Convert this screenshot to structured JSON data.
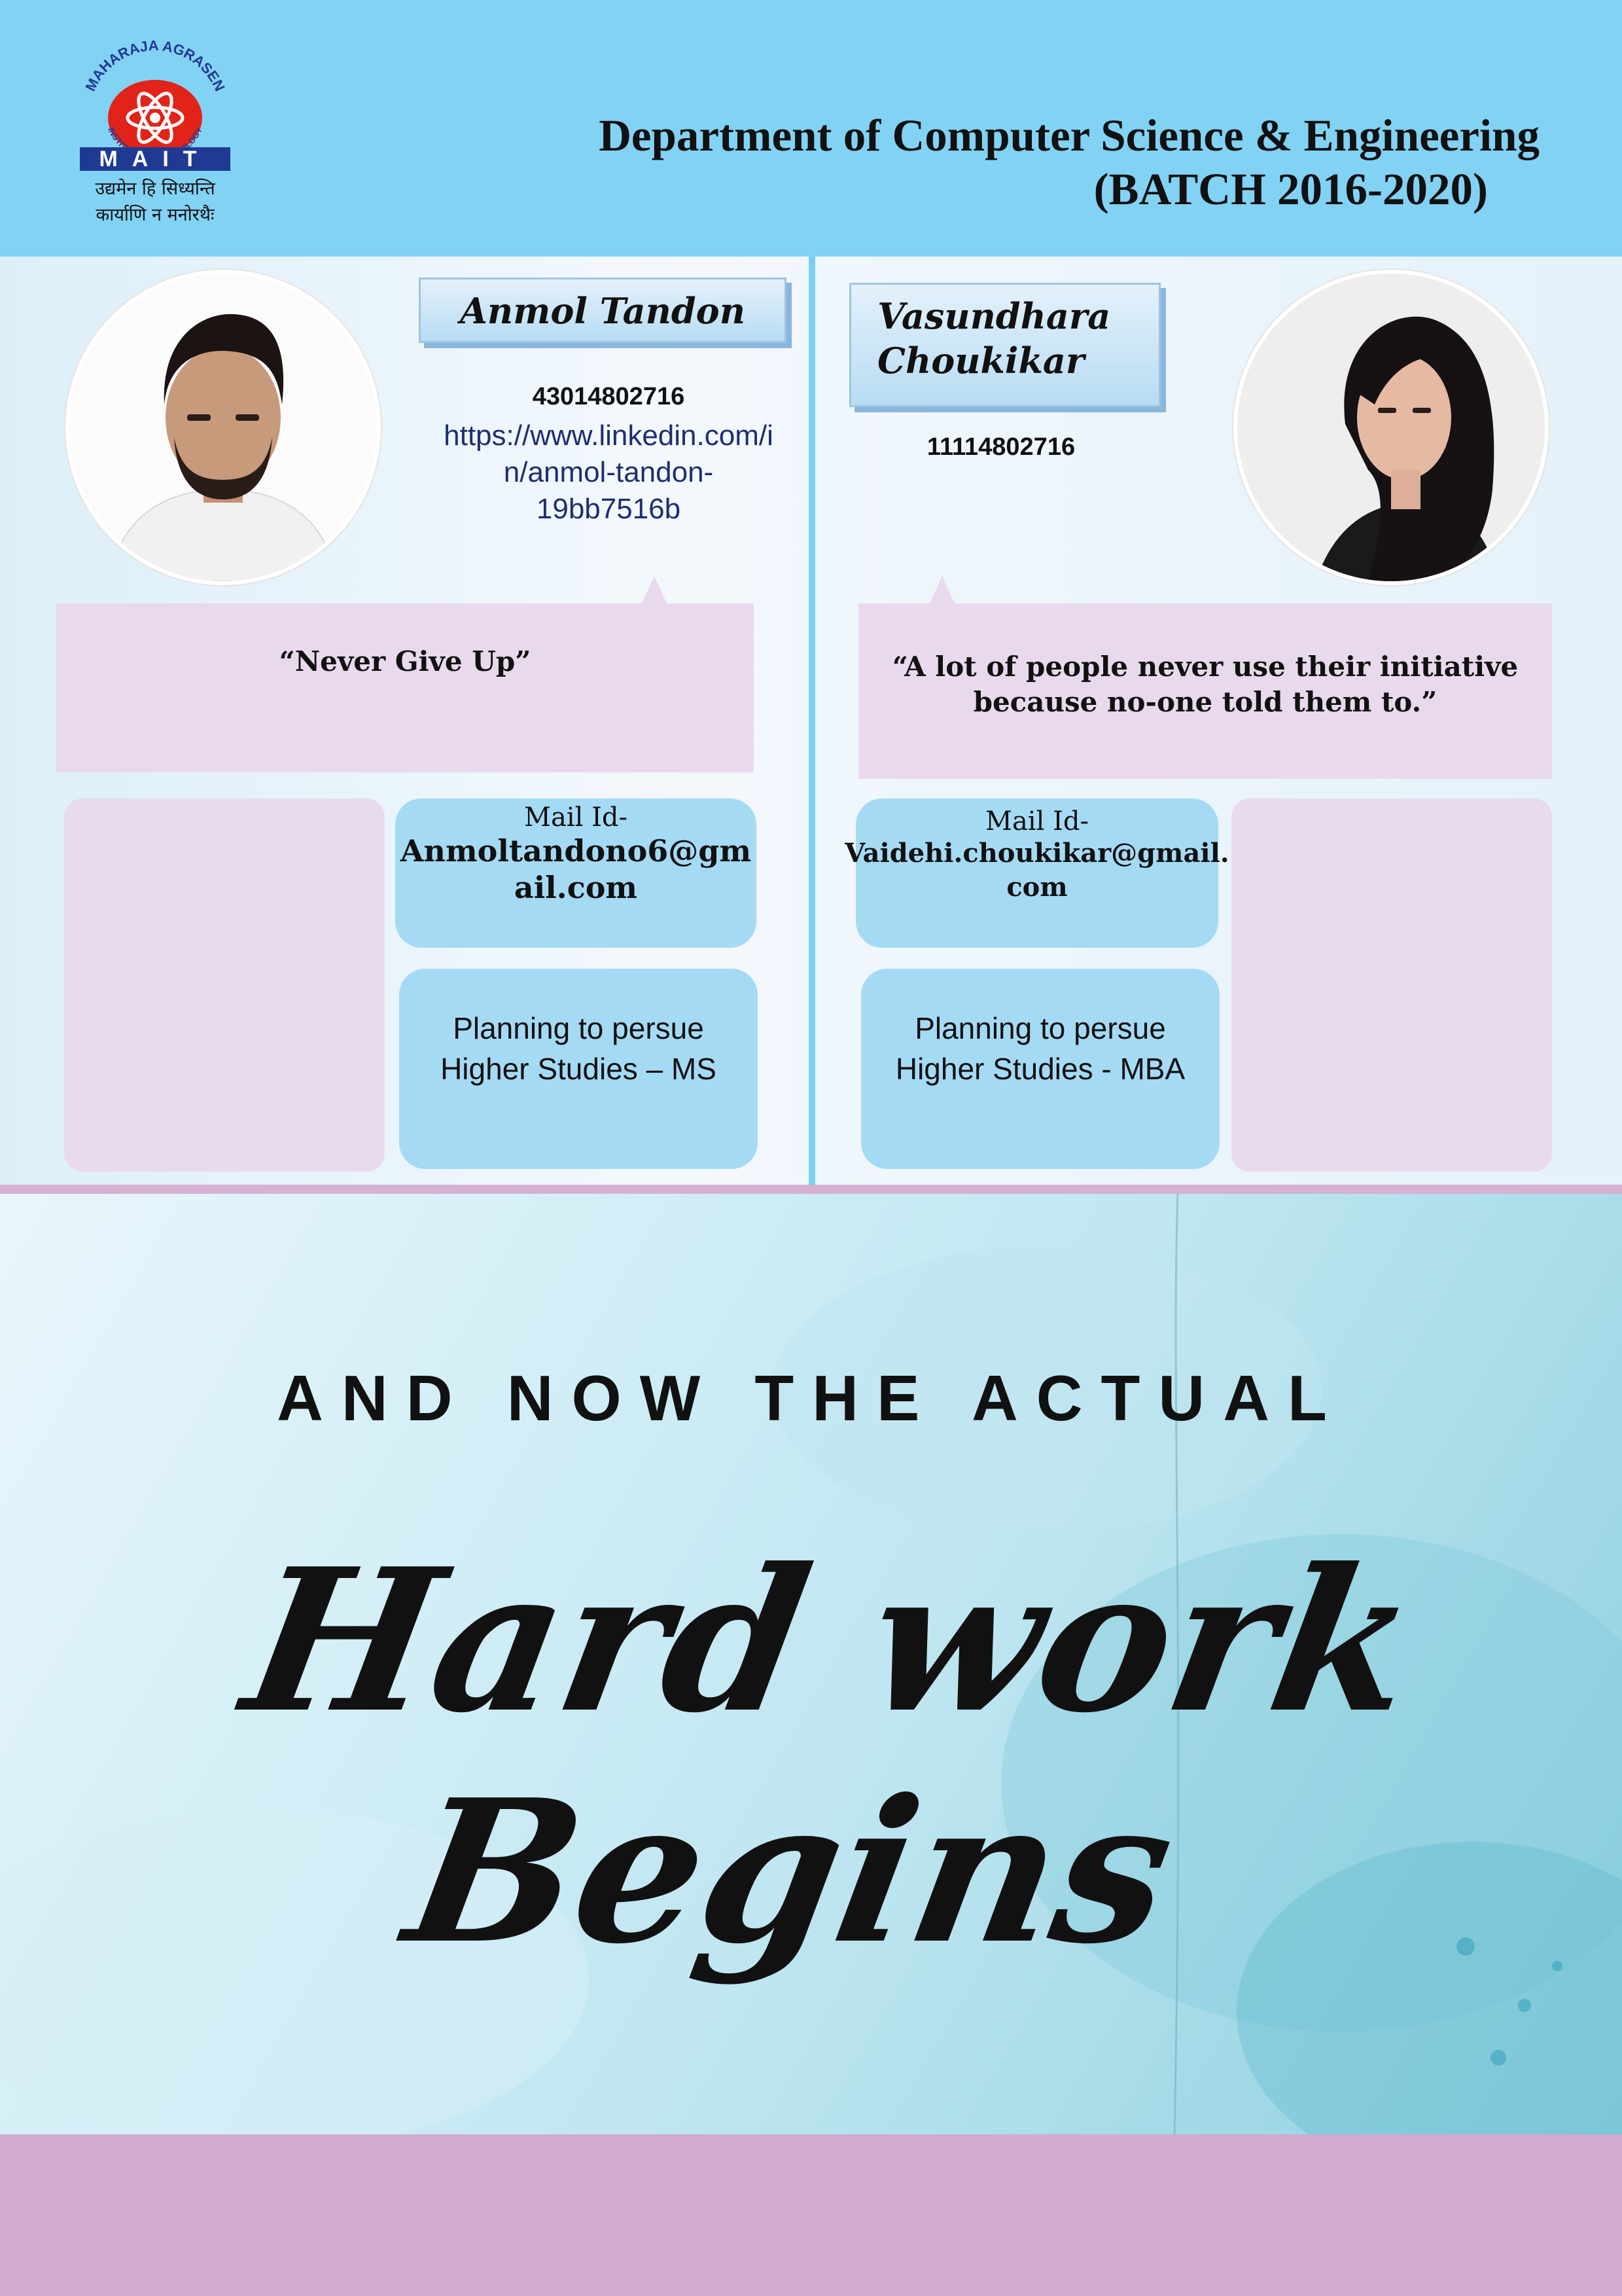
{
  "header": {
    "logo": {
      "arc_text": "MAHARAJA AGRASEN",
      "sub_text": "INSTITUTE OF TECHNOLOGY",
      "abbr": "MAIT",
      "motto_line1": "उद्यमेन हि सिध्यन्ति",
      "motto_line2": "कार्याणि न मनोरथैः"
    },
    "department": "Department of Computer Science & Engineering",
    "batch": "(BATCH 2016-2020)"
  },
  "students": [
    {
      "name": "Anmol Tandon",
      "roll": "43014802716",
      "linkedin_lines": [
        "https://www.linkedin.com/i",
        "n/anmol-tandon-",
        "19bb7516b"
      ],
      "quote": "“Never Give Up”",
      "mail_label": "Mail Id-",
      "mail_lines": [
        "Anmoltandono6@gm",
        "ail.com"
      ],
      "plan_lines": [
        "Planning to persue",
        "Higher Studies – MS"
      ]
    },
    {
      "name_lines": [
        "Vasundhara",
        "Choukikar"
      ],
      "roll": "11114802716",
      "quote_lines": [
        "“A lot of people never use their initiative",
        "because no-one told them to.”"
      ],
      "mail_label": "Mail Id-",
      "mail_lines": [
        "Vaidehi.choukikar@gmail.",
        "com"
      ],
      "plan_lines": [
        "Planning to persue",
        "Higher Studies - MBA"
      ]
    }
  ],
  "banner": {
    "line1": "AND NOW THE ACTUAL",
    "line2": "Hard work Begins"
  },
  "colors": {
    "header_bg": "#82d2f4",
    "divider": "#7ccff2",
    "card_pink": "#e8d9ec",
    "card_blue": "#a5daf5",
    "footer_band": "#d2a9cf",
    "logo_red": "#e2231a",
    "logo_blue": "#1f3a93"
  }
}
